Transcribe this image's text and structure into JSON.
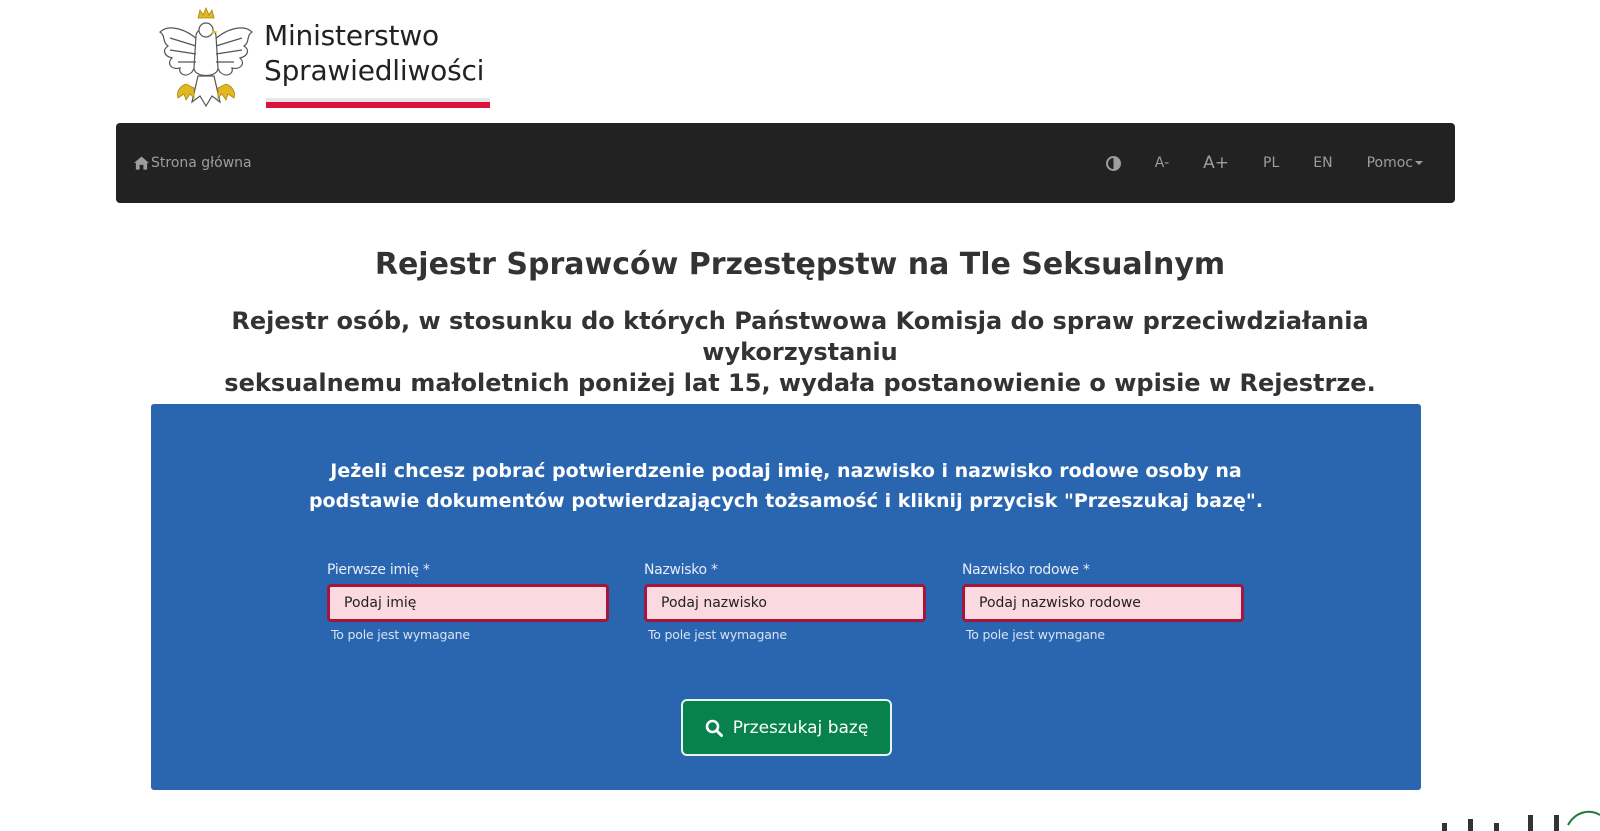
{
  "header": {
    "logo_line1": "Ministerstwo",
    "logo_line2": "Sprawiedliwości"
  },
  "navbar": {
    "home_label": "Strona główna",
    "contrast_icon": "contrast-icon",
    "font_decrease": "A-",
    "font_increase": "A+",
    "lang_pl": "PL",
    "lang_en": "EN",
    "help_label": "Pomoc"
  },
  "main": {
    "title": "Rejestr Sprawców Przestępstw na Tle Seksualnym",
    "subtitle_line1": "Rejestr osób, w stosunku do których Państwowa Komisja do spraw przeciwdziałania wykorzystaniu",
    "subtitle_line2": "seksualnemu małoletnich poniżej lat 15, wydała postanowienie o wpisie w Rejestrze."
  },
  "form": {
    "instruction_line1": "Jeżeli chcesz pobrać potwierdzenie podaj imię, nazwisko i nazwisko rodowe osoby na",
    "instruction_line2": "podstawie dokumentów potwierdzających tożsamość i kliknij przycisk \"Przeszukaj bazę\".",
    "fields": [
      {
        "label": "Pierwsze imię *",
        "placeholder": "Podaj imię",
        "value": "",
        "error": "To pole jest wymagane"
      },
      {
        "label": "Nazwisko *",
        "placeholder": "Podaj nazwisko",
        "value": "",
        "error": "To pole jest wymagane"
      },
      {
        "label": "Nazwisko rodowe *",
        "placeholder": "Podaj nazwisko rodowe",
        "value": "",
        "error": "To pole jest wymagane"
      }
    ],
    "search_button": "Przeszukaj bazę"
  },
  "colors": {
    "navbar_bg": "#222222",
    "panel_bg": "#2a65af",
    "input_error_bg": "#fbd9e0",
    "input_error_border": "#a4163a",
    "button_bg": "#07824d",
    "flag_red": "#dc143c"
  }
}
